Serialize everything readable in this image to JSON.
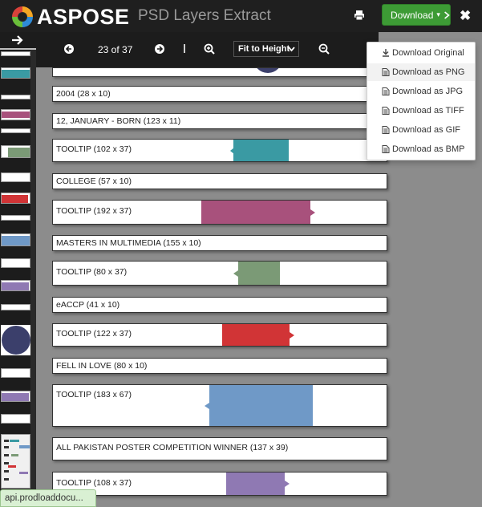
{
  "header": {
    "brand": "ASPOSE",
    "app_title": "PSD Layers Extract",
    "download_label": "Download",
    "print_icon": "print-icon",
    "close_icon": "close-icon"
  },
  "toolbar": {
    "page_indicator": "23 of 37",
    "zoom_mode": "Fit to Height"
  },
  "download_menu": [
    {
      "label": "Download Original",
      "icon": "download-icon"
    },
    {
      "label": "Download as PNG",
      "icon": "file-icon"
    },
    {
      "label": "Download as JPG",
      "icon": "file-icon"
    },
    {
      "label": "Download as TIFF",
      "icon": "file-icon"
    },
    {
      "label": "Download as GIF",
      "icon": "file-icon"
    },
    {
      "label": "Download as BMP",
      "icon": "file-icon"
    }
  ],
  "layers": [
    {
      "label": "2004 (28 x 10)"
    },
    {
      "label": "12, JANUARY - BORN (123 x 11)"
    },
    {
      "label": "TOOLTIP (102 x 37)",
      "color": "#3a9aa3"
    },
    {
      "label": "COLLEGE (57 x 10)"
    },
    {
      "label": "TOOLTIP (192 x 37)",
      "color": "#a8517c"
    },
    {
      "label": "MASTERS IN MULTIMEDIA (155 x 10)"
    },
    {
      "label": "TOOLTIP (80 x 37)",
      "color": "#7b9a76"
    },
    {
      "label": "eACCP (41 x 10)"
    },
    {
      "label": "TOOLTIP (122 x 37)",
      "color": "#d13436"
    },
    {
      "label": "FELL IN LOVE (80 x 10)"
    },
    {
      "label": "TOOLTIP (183 x 67)",
      "color": "#6f99c7"
    },
    {
      "label": "ALL PAKISTAN POSTER COMPETITION WINNER (137 x 39)"
    },
    {
      "label": "TOOLTIP (108 x 37)",
      "color": "#8f79b3"
    }
  ],
  "status_bar": {
    "text": "api.prodloaddocu..."
  },
  "colors": {
    "header_bg": "#1f1f1f",
    "download_green": "#3d9b35",
    "workspace_gray": "#8c8c8c",
    "avatar_navy": "#3b3f6b"
  }
}
